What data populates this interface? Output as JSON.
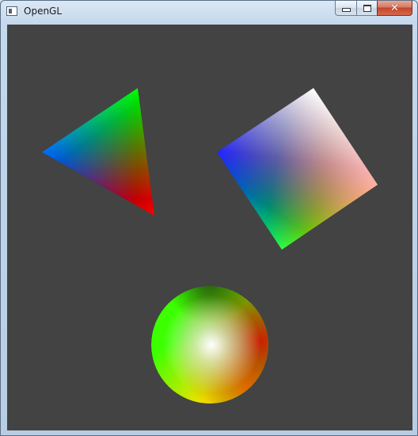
{
  "window": {
    "title": "OpenGL",
    "icon": "app-window-icon",
    "buttons": {
      "minimize": "minimize-icon",
      "maximize": "maximize-icon",
      "close": "close-icon"
    }
  },
  "scene": {
    "background_color": "#434343",
    "shapes": [
      {
        "kind": "triangle",
        "vertex_colors": [
          "#0000ff",
          "#00ff00",
          "#ff0000"
        ]
      },
      {
        "kind": "square",
        "corner_colors": [
          "#ffffff",
          "#ff0000",
          "#00ff00",
          "#0000ff"
        ]
      },
      {
        "kind": "sphere",
        "colors": [
          "#ffffff",
          "#00ff00",
          "#ffff00",
          "#ff0000"
        ]
      }
    ]
  }
}
